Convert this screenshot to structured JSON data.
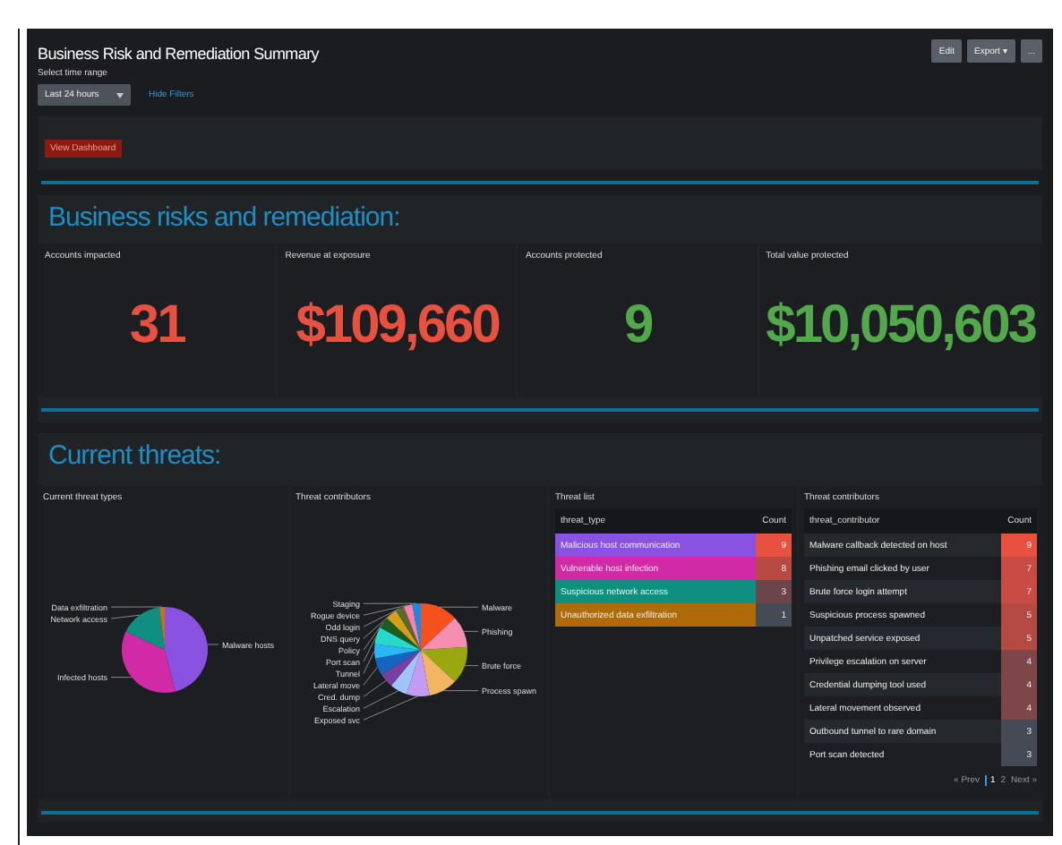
{
  "window": {
    "title": "Business Risk and Remediation Summary"
  },
  "toolbar": {
    "buttons": [
      "Edit",
      "Export ▾",
      "..."
    ]
  },
  "filters": {
    "label": "Select time range",
    "dropdown": {
      "value": "Last 24 hours"
    },
    "link": "Hide Filters"
  },
  "filter_panel": {
    "badge": "View Dashboard"
  },
  "risks": {
    "heading": "Business risks and remediation:",
    "tiles": [
      {
        "label": "Accounts impacted",
        "value": "31",
        "color": "#e8503f"
      },
      {
        "label": "Revenue at exposure",
        "value": "$109,660",
        "color": "#e8503f"
      },
      {
        "label": "Accounts protected",
        "value": "9",
        "color": "#53a84b"
      },
      {
        "label": "Total value protected",
        "value": "$10,050,603",
        "color": "#53a84b"
      }
    ]
  },
  "threats": {
    "heading": "Current threats:",
    "pie_threat_types": {
      "chart_data": {
        "type": "pie",
        "title": "Current threat types",
        "categories": [
          "Malware hosts",
          "Infected hosts",
          "Network access",
          "Data exfiltration"
        ],
        "series": [
          {
            "colors": [
              "#8a52e0",
              "#d12aa6",
              "#0f8f80",
              "#c0741a"
            ],
            "values": [
              46,
              36,
              16,
              2
            ]
          }
        ]
      }
    },
    "pie_threat_contributors": {
      "chart_data": {
        "type": "pie",
        "title": "Threat contributors",
        "categories": [
          "Malware",
          "Phishing",
          "Brute force",
          "Process spawn",
          "Exposed svc",
          "Escalation",
          "Cred. dump",
          "Lateral move",
          "Tunnel",
          "Port scan",
          "Policy",
          "DNS query",
          "Odd login",
          "Rogue device",
          "Staging"
        ],
        "series": [
          {
            "colors": [
              "#f4511e",
              "#f48fb1",
              "#9aa80f",
              "#f3b562",
              "#c39bf2",
              "#9fc5f8",
              "#7b3fa0",
              "#1565c0",
              "#29b6f6",
              "#26d9c8",
              "#1b5e20",
              "#d4a017",
              "#556b2f",
              "#ff80ab",
              "#1e88e5"
            ],
            "values": [
              13,
              11,
              13,
              10,
              8,
              6,
              5,
              6,
              5,
              6,
              4,
              4,
              3,
              3,
              3
            ]
          }
        ]
      }
    },
    "threat_list": {
      "title": "Threat list",
      "columns": [
        "threat_type",
        "Count"
      ],
      "rows": [
        {
          "name": "Malicious host communication",
          "color": "#8a52e0",
          "count": {
            "text": "9",
            "color": "#e8503f"
          }
        },
        {
          "name": "Vulnerable host infection",
          "color": "#d12aa6",
          "count": {
            "text": "8",
            "color": "#b84a43"
          }
        },
        {
          "name": "Suspicious network access",
          "color": "#0f8f80",
          "count": {
            "text": "3",
            "color": "#6b4549"
          }
        },
        {
          "name": "Unauthorized data exfiltration",
          "color": "#b06a0a",
          "count": {
            "text": "1",
            "color": "#454b55"
          }
        }
      ]
    },
    "contributors": {
      "title": "Threat contributors",
      "columns": [
        "threat_contributor",
        "Count"
      ],
      "rows": [
        {
          "name": "Malware callback detected on host",
          "count": {
            "text": "9",
            "color": "#e8503f"
          }
        },
        {
          "name": "Phishing email clicked by user",
          "count": {
            "text": "7",
            "color": "#c94c44"
          }
        },
        {
          "name": "Brute force login attempt",
          "count": {
            "text": "7",
            "color": "#c94c44"
          }
        },
        {
          "name": "Suspicious process spawned",
          "count": {
            "text": "5",
            "color": "#b54a45"
          }
        },
        {
          "name": "Unpatched service exposed",
          "count": {
            "text": "5",
            "color": "#b54a45"
          }
        },
        {
          "name": "Privilege escalation on server",
          "count": {
            "text": "4",
            "color": "#7d4649"
          }
        },
        {
          "name": "Credential dumping tool used",
          "count": {
            "text": "4",
            "color": "#7d4649"
          }
        },
        {
          "name": "Lateral movement observed",
          "count": {
            "text": "4",
            "color": "#7d4649"
          }
        },
        {
          "name": "Outbound tunnel to rare domain",
          "count": {
            "text": "3",
            "color": "#454b55"
          }
        },
        {
          "name": "Port scan detected",
          "count": {
            "text": "3",
            "color": "#454b55"
          }
        }
      ],
      "pagination": [
        {
          "label": "« Prev",
          "selected": false
        },
        {
          "label": "1",
          "selected": true
        },
        {
          "label": "2",
          "selected": false
        },
        {
          "label": "Next »",
          "selected": false
        }
      ]
    }
  }
}
